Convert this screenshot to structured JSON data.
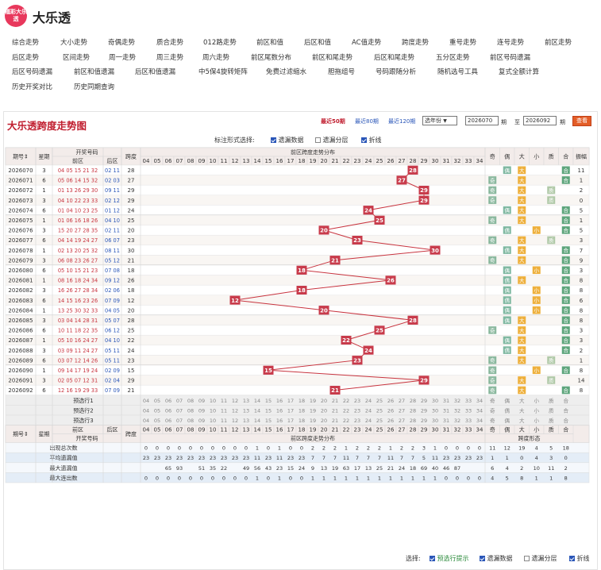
{
  "app": {
    "logo_text": "福彩大乐透",
    "title": "大乐透"
  },
  "nav": [
    [
      "综合走势",
      "大小走势",
      "奇偶走势",
      "质合走势",
      "012路走势",
      "前区和值",
      "后区和值",
      "AC值走势",
      "跨度走势",
      "重号走势",
      "连号走势",
      "前区走势"
    ],
    [
      "后区走势",
      "区间走势",
      "周一走势",
      "周三走势",
      "周六走势",
      "前区尾数分布",
      "前区和尾走势",
      "后区和尾走势",
      "五分区走势",
      "前区号码遗漏"
    ],
    [
      "后区号码遗漏",
      "前区和值遗漏",
      "后区和值遗漏",
      "中5保4旋转矩阵",
      "免费过滤缩水",
      "胆拖组号",
      "号码跟随分析",
      "随机选号工具",
      "复式全额计算"
    ],
    [
      "历史开奖对比",
      "历史同期查询"
    ]
  ],
  "panel": {
    "title": "大乐透跨度走势图",
    "periods": [
      "最近50期",
      "最近80期",
      "最近120期"
    ],
    "year_select": "选年份",
    "from_value": "2026070",
    "qi1": "期",
    "to_label": "至",
    "to_value": "2026092",
    "qi2": "期",
    "query_button": "查看"
  },
  "marks": {
    "label": "标注形式选择:",
    "options": [
      {
        "text": "遗漏数据",
        "checked": true
      },
      {
        "text": "遗漏分层",
        "checked": false
      },
      {
        "text": "折线",
        "checked": true
      }
    ]
  },
  "table_headers": {
    "period": "期号",
    "week": "星期",
    "draw": "开奖号码",
    "front": "前区",
    "back": "后区",
    "span": "跨度",
    "dist": "前区跨度走势分布",
    "forms": "跨度形态",
    "form_cols": [
      "奇",
      "偶",
      "大",
      "小",
      "质",
      "合",
      "振幅"
    ],
    "predict": [
      "预选行1",
      "预选行2",
      "预选行3"
    ],
    "bottom_stats": [
      "出现总次数",
      "平均遗漏值",
      "最大遗漏值",
      "最大连出数"
    ],
    "period_sort": "期号⇕",
    "draw_label": "开奖号码"
  },
  "chart_data": {
    "type": "table",
    "columns": [
      4,
      5,
      6,
      7,
      8,
      9,
      10,
      11,
      12,
      13,
      14,
      15,
      16,
      17,
      18,
      19,
      20,
      21,
      22,
      23,
      24,
      25,
      26,
      27,
      28,
      29,
      30,
      31,
      32,
      33,
      34
    ],
    "rows": [
      {
        "p": "2026070",
        "w": "3",
        "f": "04 05 15 21 32",
        "b": "02 11",
        "s": 28,
        "forms": [
          "",
          "偶",
          "大",
          "",
          "",
          "合"
        ],
        "amp": "11"
      },
      {
        "p": "2026071",
        "w": "6",
        "f": "05 06 14 15 32",
        "b": "02 03",
        "s": 27,
        "forms": [
          "奇",
          "",
          "大",
          "",
          "",
          "合"
        ],
        "amp": "1"
      },
      {
        "p": "2026072",
        "w": "1",
        "f": "01 13 26 29 30",
        "b": "09 11",
        "s": 29,
        "forms": [
          "奇",
          "",
          "大",
          "",
          "质",
          ""
        ],
        "amp": "2"
      },
      {
        "p": "2026073",
        "w": "3",
        "f": "04 10 22 23 33",
        "b": "02 12",
        "s": 29,
        "forms": [
          "奇",
          "",
          "大",
          "",
          "质",
          ""
        ],
        "amp": "0"
      },
      {
        "p": "2026074",
        "w": "6",
        "f": "01 04 10 23 25",
        "b": "01 12",
        "s": 24,
        "forms": [
          "",
          "偶",
          "大",
          "",
          "",
          "合"
        ],
        "amp": "5"
      },
      {
        "p": "2026075",
        "w": "1",
        "f": "01 06 16 18 26",
        "b": "04 10",
        "s": 25,
        "forms": [
          "奇",
          "",
          "大",
          "",
          "",
          "合"
        ],
        "amp": "1"
      },
      {
        "p": "2026076",
        "w": "3",
        "f": "15 20 27 28 35",
        "b": "02 11",
        "s": 20,
        "forms": [
          "",
          "偶",
          "",
          "小",
          "",
          "合"
        ],
        "amp": "5"
      },
      {
        "p": "2026077",
        "w": "6",
        "f": "04 14 19 24 27",
        "b": "06 07",
        "s": 23,
        "forms": [
          "奇",
          "",
          "大",
          "",
          "质",
          ""
        ],
        "amp": "3"
      },
      {
        "p": "2026078",
        "w": "1",
        "f": "02 13 20 25 32",
        "b": "08 11",
        "s": 30,
        "forms": [
          "",
          "偶",
          "大",
          "",
          "",
          "合"
        ],
        "amp": "7"
      },
      {
        "p": "2026079",
        "w": "3",
        "f": "06 08 23 26 27",
        "b": "05 12",
        "s": 21,
        "forms": [
          "奇",
          "",
          "大",
          "",
          "",
          "合"
        ],
        "amp": "9"
      },
      {
        "p": "2026080",
        "w": "6",
        "f": "05 10 15 21 23",
        "b": "07 08",
        "s": 18,
        "forms": [
          "",
          "偶",
          "",
          "小",
          "",
          "合"
        ],
        "amp": "3"
      },
      {
        "p": "2026081",
        "w": "1",
        "f": "08 16 18 24 34",
        "b": "09 12",
        "s": 26,
        "forms": [
          "",
          "偶",
          "大",
          "",
          "",
          "合"
        ],
        "amp": "8"
      },
      {
        "p": "2026082",
        "w": "3",
        "f": "16 26 27 28 34",
        "b": "02 06",
        "s": 18,
        "forms": [
          "",
          "偶",
          "",
          "小",
          "",
          "合"
        ],
        "amp": "8"
      },
      {
        "p": "2026083",
        "w": "6",
        "f": "14 15 16 23 26",
        "b": "07 09",
        "s": 12,
        "forms": [
          "",
          "偶",
          "",
          "小",
          "",
          "合"
        ],
        "amp": "6"
      },
      {
        "p": "2026084",
        "w": "1",
        "f": "13 25 30 32 33",
        "b": "04 05",
        "s": 20,
        "forms": [
          "",
          "偶",
          "",
          "小",
          "",
          "合"
        ],
        "amp": "8"
      },
      {
        "p": "2026085",
        "w": "3",
        "f": "03 04 14 28 31",
        "b": "05 07",
        "s": 28,
        "forms": [
          "",
          "偶",
          "大",
          "",
          "",
          "合"
        ],
        "amp": "8"
      },
      {
        "p": "2026086",
        "w": "6",
        "f": "10 11 18 22 35",
        "b": "06 12",
        "s": 25,
        "forms": [
          "奇",
          "",
          "大",
          "",
          "",
          "合"
        ],
        "amp": "3"
      },
      {
        "p": "2026087",
        "w": "1",
        "f": "05 10 16 24 27",
        "b": "04 10",
        "s": 22,
        "forms": [
          "",
          "偶",
          "大",
          "",
          "",
          "合"
        ],
        "amp": "3"
      },
      {
        "p": "2026088",
        "w": "3",
        "f": "03 09 11 24 27",
        "b": "05 11",
        "s": 24,
        "forms": [
          "",
          "偶",
          "大",
          "",
          "",
          "合"
        ],
        "amp": "2"
      },
      {
        "p": "2026089",
        "w": "6",
        "f": "03 07 12 14 26",
        "b": "05 11",
        "s": 23,
        "forms": [
          "奇",
          "",
          "大",
          "",
          "质",
          ""
        ],
        "amp": "1"
      },
      {
        "p": "2026090",
        "w": "1",
        "f": "09 14 17 19 24",
        "b": "02 09",
        "s": 15,
        "forms": [
          "奇",
          "",
          "",
          "小",
          "",
          "合"
        ],
        "amp": "8"
      },
      {
        "p": "2026091",
        "w": "3",
        "f": "02 05 07 12 31",
        "b": "02 04",
        "s": 29,
        "forms": [
          "奇",
          "",
          "大",
          "",
          "质",
          ""
        ],
        "amp": "14"
      },
      {
        "p": "2026092",
        "w": "6",
        "f": "12 16 19 29 33",
        "b": "07 09",
        "s": 21,
        "forms": [
          "奇",
          "",
          "大",
          "",
          "",
          "合"
        ],
        "amp": "8"
      }
    ],
    "stats": {
      "count": [
        "0",
        "0",
        "0",
        "0",
        "0",
        "0",
        "0",
        "0",
        "0",
        "0",
        "1",
        "0",
        "1",
        "0",
        "0",
        "2",
        "2",
        "2",
        "1",
        "2",
        "2",
        "2",
        "1",
        "2",
        "2",
        "3",
        "1",
        "0",
        "0",
        "0",
        "0"
      ],
      "avg": [
        "23",
        "23",
        "23",
        "23",
        "23",
        "23",
        "23",
        "23",
        "23",
        "23",
        "11",
        "23",
        "11",
        "23",
        "23",
        "7",
        "7",
        "7",
        "11",
        "7",
        "7",
        "7",
        "11",
        "7",
        "7",
        "5",
        "11",
        "23",
        "23",
        "23",
        "23"
      ],
      "max": [
        "",
        "",
        "65",
        "93",
        "",
        "51",
        "35",
        "22",
        "",
        "49",
        "56",
        "43",
        "23",
        "15",
        "24",
        "9",
        "13",
        "19",
        "63",
        "17",
        "13",
        "25",
        "21",
        "24",
        "18",
        "69",
        "40",
        "46",
        "87",
        "",
        " "
      ],
      "maxrun": [
        "0",
        "0",
        "0",
        "0",
        "0",
        "0",
        "0",
        "0",
        "0",
        "0",
        "1",
        "0",
        "1",
        "0",
        "0",
        "1",
        "1",
        "1",
        "1",
        "1",
        "1",
        "1",
        "1",
        "1",
        "1",
        "1",
        "1",
        "0",
        "0",
        "0",
        "0"
      ],
      "form_count": [
        "11",
        "12",
        "19",
        "4",
        "5",
        "18"
      ],
      "form_avg": [
        "1",
        "1",
        "0",
        "4",
        "3",
        "0"
      ],
      "form_max": [
        "6",
        "4",
        "2",
        "10",
        "11",
        "2"
      ],
      "form_run": [
        "4",
        "5",
        "8",
        "1",
        "1",
        "8"
      ]
    }
  },
  "footer": {
    "label": "选择:",
    "options": [
      {
        "text": "预选行提示",
        "checked": true
      },
      {
        "text": "遗漏数据",
        "checked": true
      },
      {
        "text": "遗漏分层",
        "checked": false
      },
      {
        "text": "折线",
        "checked": true
      }
    ]
  },
  "colors": {
    "accent": "#c01d2e",
    "ball": "#c83b4b",
    "line": "#c8343f",
    "odd": "#7fb8a1",
    "big": "#f3b235",
    "small": "#f3b235",
    "prime": "#b0c9a8",
    "comp": "#70b18f"
  }
}
